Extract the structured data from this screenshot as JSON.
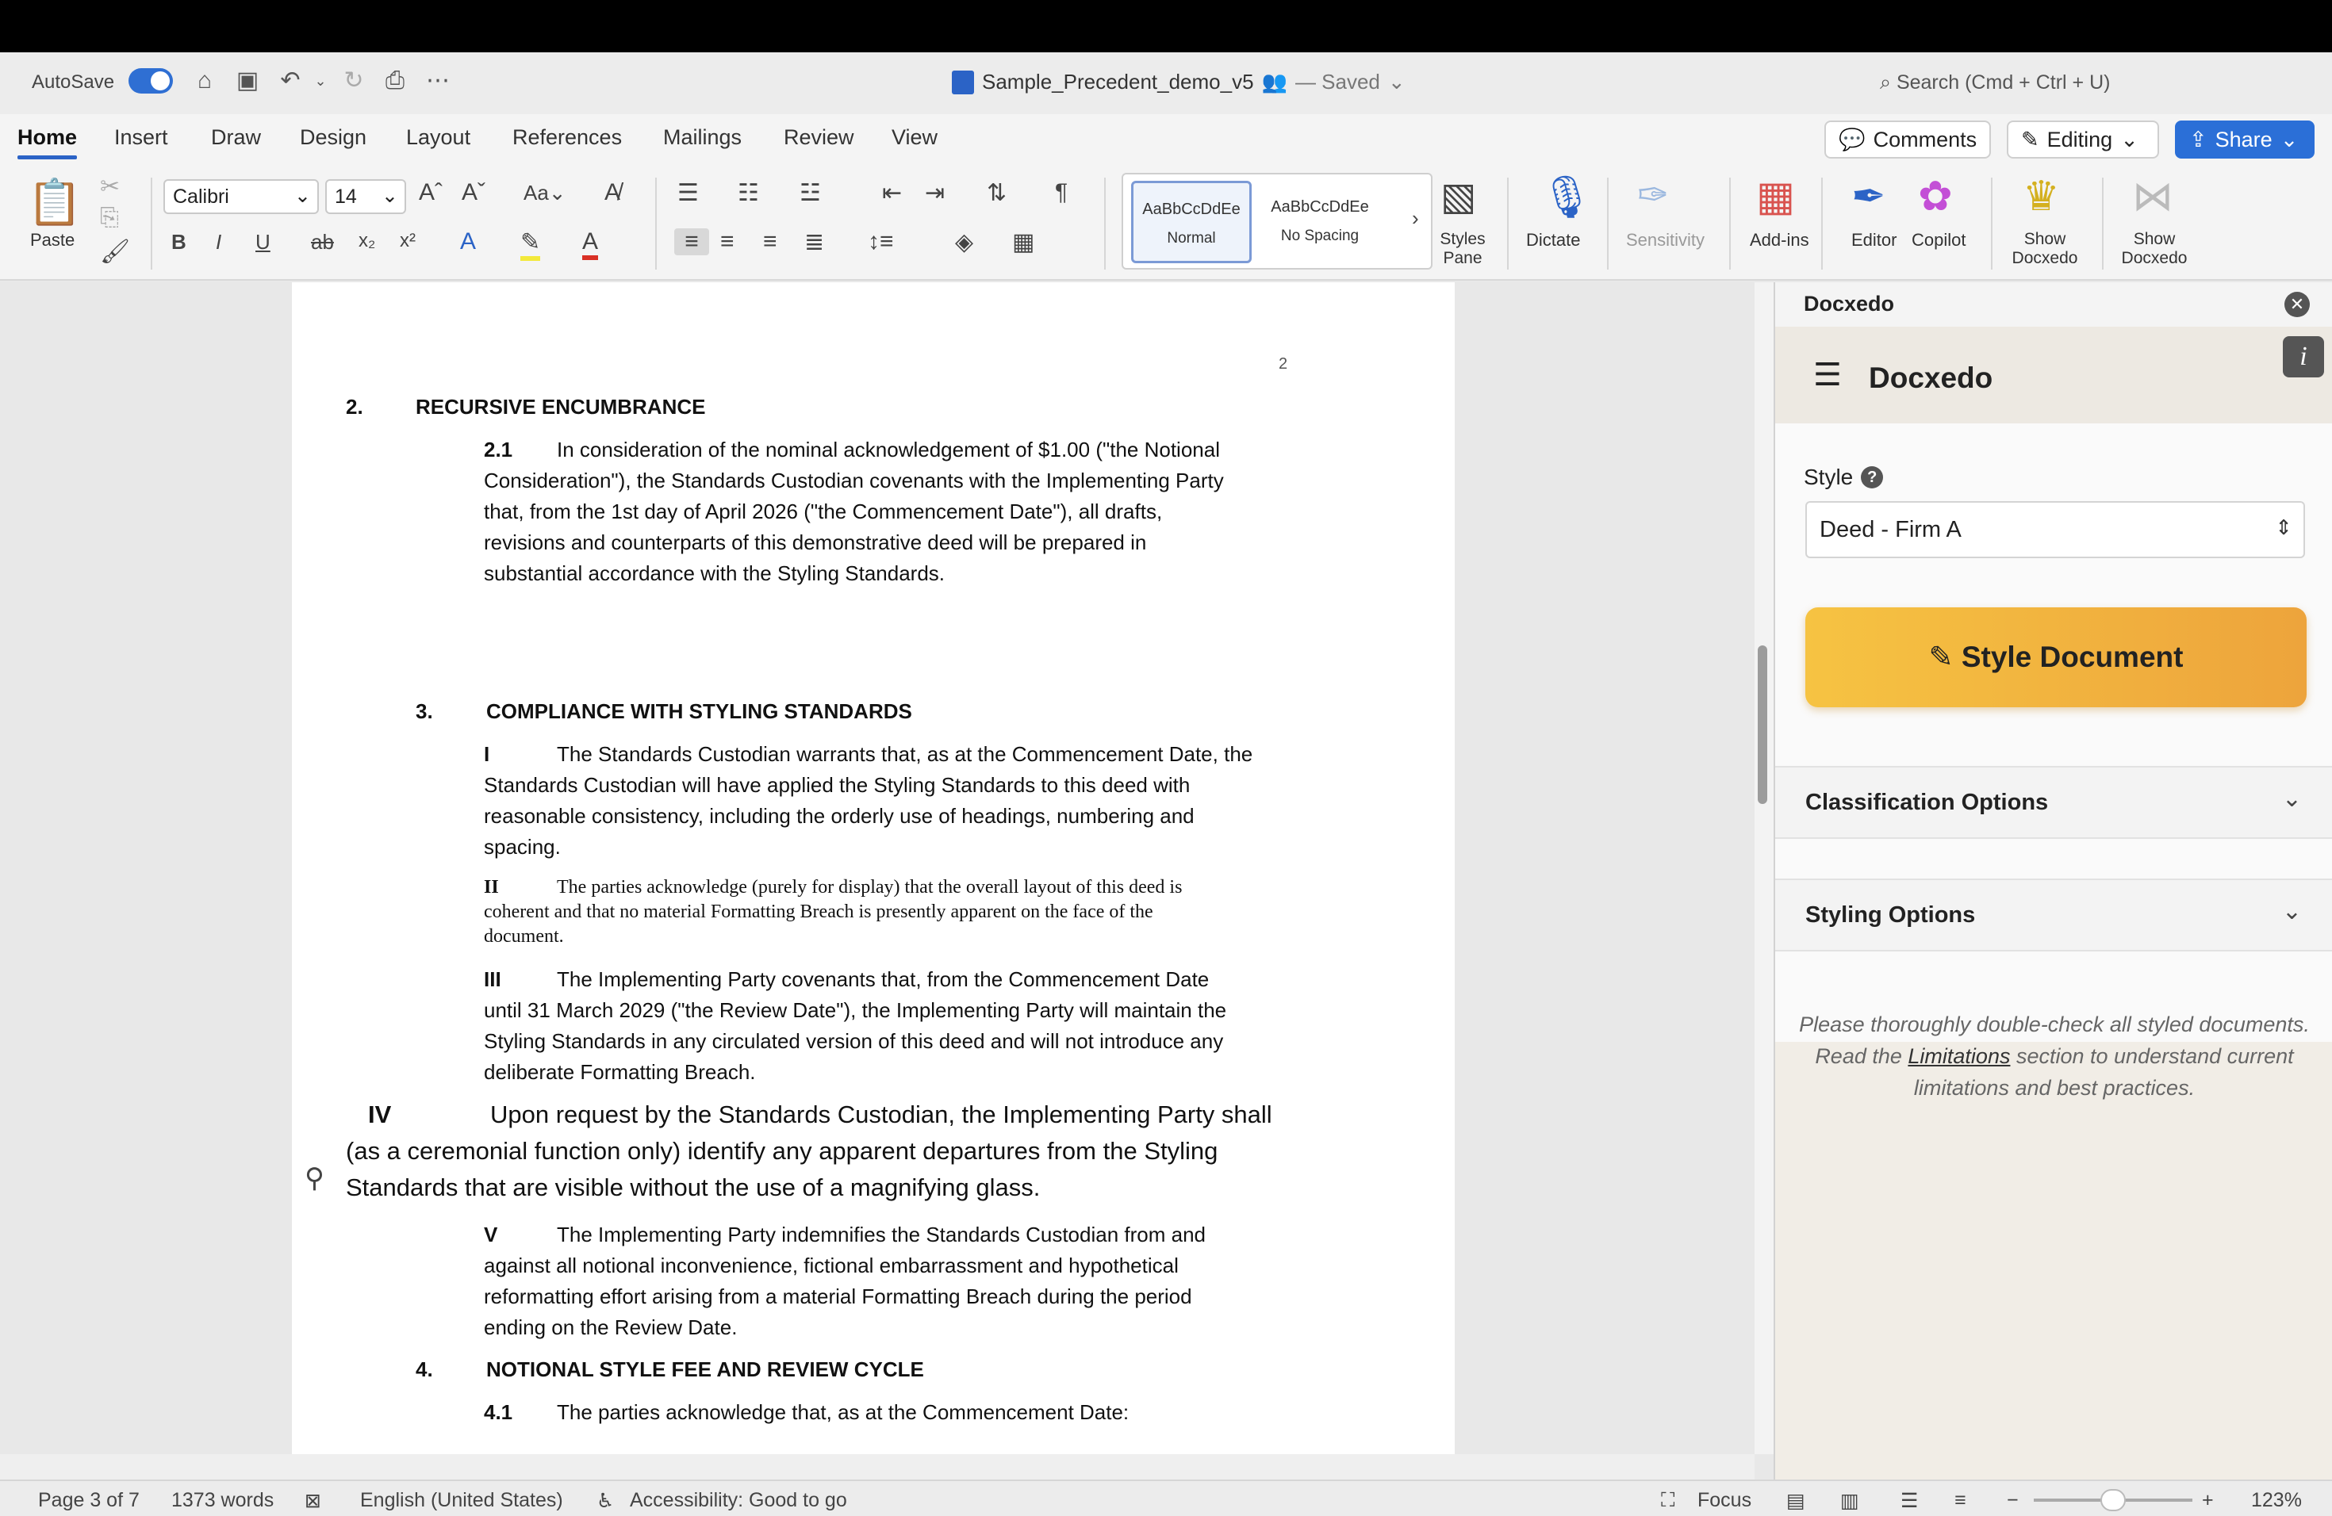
{
  "titlebar": {
    "autosave": "AutoSave",
    "doc_title": "Sample_Precedent_demo_v5",
    "saved": "— Saved",
    "search": "Search (Cmd + Ctrl + U)"
  },
  "tabs": [
    "Home",
    "Insert",
    "Draw",
    "Design",
    "Layout",
    "References",
    "Mailings",
    "Review",
    "View"
  ],
  "tab_buttons": {
    "comments": "Comments",
    "editing": "Editing",
    "share": "Share"
  },
  "ribbon": {
    "paste": "Paste",
    "font": "Calibri",
    "font_size": "14",
    "style_normal_sample": "AaBbCcDdEe",
    "style_normal": "Normal",
    "style_nospacing_sample": "AaBbCcDdEe",
    "style_nospacing": "No Spacing",
    "styles_pane": "Styles Pane",
    "dictate": "Dictate",
    "sensitivity": "Sensitivity",
    "addins": "Add-ins",
    "editor": "Editor",
    "copilot": "Copilot",
    "show_docxedo_1": "Show Docxedo",
    "show_docxedo_2": "Show Docxedo"
  },
  "document": {
    "page_number": "2",
    "s2_num": "2.",
    "s2_title": "RECURSIVE ENCUMBRANCE",
    "p21_num": "2.1",
    "p21_l1": "In consideration of the nominal acknowledgement of $1.00 (\"the Notional",
    "p21_l2": "Consideration\"), the Standards Custodian covenants with the Implementing Party",
    "p21_l3": "that, from the 1st day of April 2026 (\"the Commencement Date\"), all drafts,",
    "p21_l4": "revisions and counterparts of this demonstrative deed will be prepared in",
    "p21_l5": "substantial accordance with the Styling Standards.",
    "s3_num": "3.",
    "s3_title": "COMPLIANCE WITH STYLING STANDARDS",
    "pI_num": "I",
    "pI_l1": "The Standards Custodian warrants that, as at the Commencement Date, the",
    "pI_l2": "Standards Custodian will have applied the Styling Standards to this deed with",
    "pI_l3": "reasonable consistency, including the orderly use of headings, numbering and",
    "pI_l4": "spacing.",
    "pII_num": "II",
    "pII_l1": "The parties acknowledge (purely for display) that the overall layout of this deed is",
    "pII_l2": "coherent and that no material Formatting Breach is presently apparent on the face of the",
    "pII_l3": "document.",
    "pIII_num": "III",
    "pIII_l1": "The Implementing Party covenants that, from the Commencement Date",
    "pIII_l2": "until 31 March 2029 (\"the Review Date\"), the Implementing Party will maintain the",
    "pIII_l3": "Styling Standards in any circulated version of this deed and will not introduce any",
    "pIII_l4": "deliberate Formatting Breach.",
    "pIV_num": "IV",
    "pIV_l1": "Upon request by the Standards Custodian, the Implementing Party shall",
    "pIV_l2": "(as a    ceremonial function only) identify any apparent departures from the Styling",
    "pIV_l3": "Standards that are visible without the use of a magnifying glass.",
    "pV_num": "V",
    "pV_l1": "The Implementing Party indemnifies the Standards Custodian from and",
    "pV_l2": "against all notional inconvenience, fictional embarrassment and hypothetical",
    "pV_l3": "reformatting effort arising from a material Formatting Breach during the period",
    "pV_l4": "ending on the Review Date.",
    "s4_num": "4.",
    "s4_title": "NOTIONAL STYLE FEE AND REVIEW CYCLE",
    "p41_num": "4.1",
    "p41_l1": "The parties acknowledge that, as at the Commencement Date:"
  },
  "panel": {
    "header": "Docxedo",
    "brand": "Docxedo",
    "style_label": "Style",
    "style_value": "Deed - Firm A",
    "style_button": "Style Document",
    "classification": "Classification Options",
    "styling": "Styling Options",
    "disclaimer_a": "Please thoroughly double-check all styled documents. Read the ",
    "disclaimer_link": "Limitations",
    "disclaimer_b": " section to understand current limitations and best practices."
  },
  "status": {
    "page": "Page 3 of 7",
    "words": "1373 words",
    "language": "English (United States)",
    "accessibility": "Accessibility: Good to go",
    "focus": "Focus",
    "zoom": "123%"
  }
}
